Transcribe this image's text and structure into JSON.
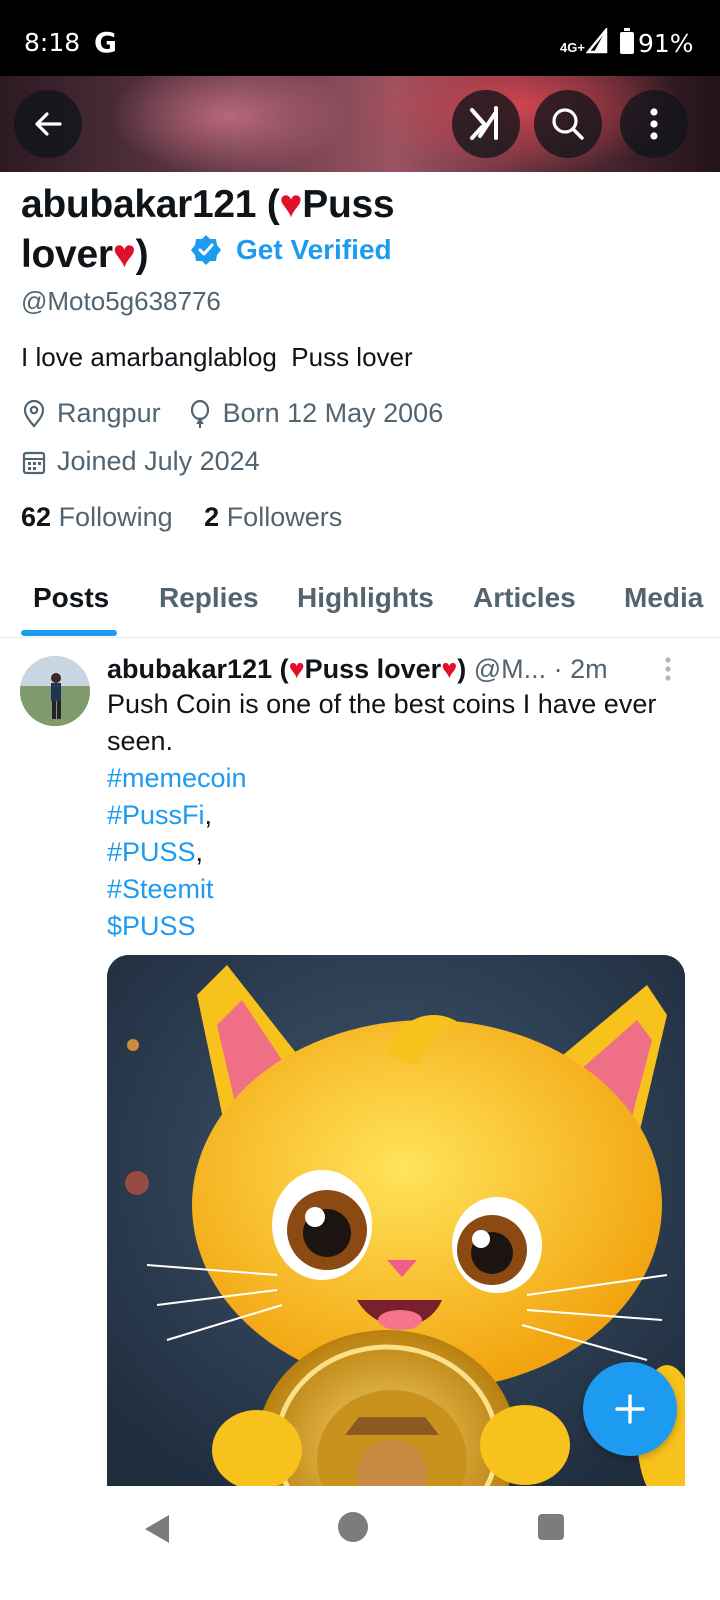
{
  "status_bar": {
    "time": "8:18",
    "g_label": "G",
    "network": "4G+",
    "battery": "91%"
  },
  "profile": {
    "name_part1": "abubakar121 (",
    "name_part2": "Puss",
    "name_part3": "lover",
    "name_part4": ")",
    "get_verified": "Get Verified",
    "handle": "@Moto5g638776",
    "bio": "I love amarbanglablog  Puss lover",
    "location": "Rangpur",
    "birth": "Born 12 May 2006",
    "joined": "Joined July 2024",
    "following_count": "62",
    "following_label": "Following",
    "followers_count": "2",
    "followers_label": "Followers"
  },
  "tabs": [
    "Posts",
    "Replies",
    "Highlights",
    "Articles",
    "Media"
  ],
  "post": {
    "author_part1": "abubakar121 (",
    "author_part2": "Puss lover",
    "author_part3": ")",
    "handle": "@M...",
    "time": "· 2m",
    "text": "Push Coin is one of the best coins I have ever seen.",
    "tags": [
      "#memecoin",
      "#PussFi",
      "#PUSS",
      "#Steemit",
      "$PUSS"
    ],
    "tag_suffix": [
      ",",
      ","
    ]
  },
  "colors": {
    "accent": "#1d9bf0",
    "heart": "#e0102a",
    "muted": "#536471"
  },
  "icons": [
    "back-arrow-icon",
    "grok-icon",
    "search-icon",
    "more-vertical-icon",
    "location-icon",
    "balloon-icon",
    "calendar-icon",
    "plus-icon",
    "verified-badge-icon"
  ]
}
